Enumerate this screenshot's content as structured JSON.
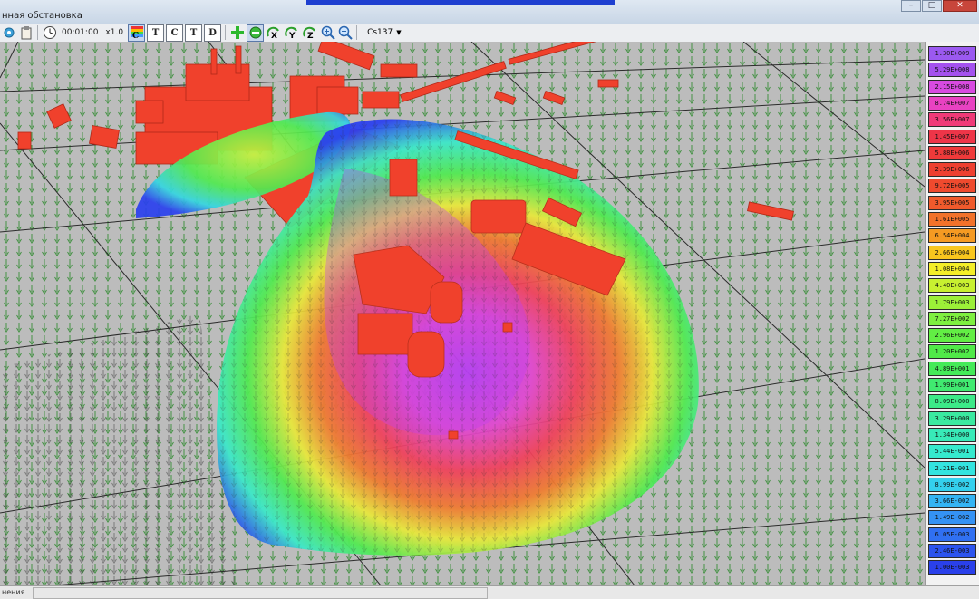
{
  "window": {
    "title": "нная обстановка"
  },
  "toolbar": {
    "time": "00:01:00",
    "speed": "x1.0",
    "isotope": "Cs137"
  },
  "legend": [
    {
      "label": "1.30E+009",
      "color": "#9b59f0"
    },
    {
      "label": "5.29E+008",
      "color": "#a451ee"
    },
    {
      "label": "2.15E+008",
      "color": "#d84ae0"
    },
    {
      "label": "8.74E+007",
      "color": "#e842c2"
    },
    {
      "label": "3.56E+007",
      "color": "#f03a78"
    },
    {
      "label": "1.45E+007",
      "color": "#ee3548"
    },
    {
      "label": "5.88E+006",
      "color": "#ee3a3a"
    },
    {
      "label": "2.39E+006",
      "color": "#ee4030"
    },
    {
      "label": "9.72E+005",
      "color": "#ef4a2e"
    },
    {
      "label": "3.95E+005",
      "color": "#f05a2c"
    },
    {
      "label": "1.61E+005",
      "color": "#f2722a"
    },
    {
      "label": "6.54E+004",
      "color": "#f59a22"
    },
    {
      "label": "2.66E+004",
      "color": "#f8c61e"
    },
    {
      "label": "1.08E+004",
      "color": "#f4ee28"
    },
    {
      "label": "4.40E+003",
      "color": "#c8f030"
    },
    {
      "label": "1.79E+003",
      "color": "#9cf038"
    },
    {
      "label": "7.27E+002",
      "color": "#7ef040"
    },
    {
      "label": "2.96E+002",
      "color": "#62ee44"
    },
    {
      "label": "1.20E+002",
      "color": "#50ea48"
    },
    {
      "label": "4.89E+001",
      "color": "#44ea58"
    },
    {
      "label": "1.99E+001",
      "color": "#40ea70"
    },
    {
      "label": "8.09E+000",
      "color": "#3cea88"
    },
    {
      "label": "3.29E+000",
      "color": "#3aeaa0"
    },
    {
      "label": "1.34E+000",
      "color": "#38eab8"
    },
    {
      "label": "5.44E-001",
      "color": "#36eace"
    },
    {
      "label": "2.21E-001",
      "color": "#34e4e0"
    },
    {
      "label": "8.99E-002",
      "color": "#34d0ee"
    },
    {
      "label": "3.66E-002",
      "color": "#34b4f4"
    },
    {
      "label": "1.49E-002",
      "color": "#3492f4"
    },
    {
      "label": "6.05E-003",
      "color": "#3070f2"
    },
    {
      "label": "2.46E-003",
      "color": "#2c54ee"
    },
    {
      "label": "1.00E-003",
      "color": "#2a40ea"
    }
  ],
  "status": {
    "text": "нения"
  },
  "colors": {
    "building": "#f0412c",
    "ground": "#bdbdbd",
    "arrow": "#2f8a2f"
  }
}
